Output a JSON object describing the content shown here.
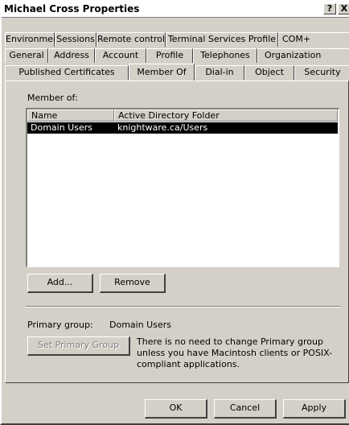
{
  "window": {
    "title": "Michael Cross Properties",
    "help_button": "?",
    "close_button": "X"
  },
  "tabs": {
    "row1": [
      "Environment",
      "Sessions",
      "Remote control",
      "Terminal Services Profile",
      "COM+"
    ],
    "row2": [
      "General",
      "Address",
      "Account",
      "Profile",
      "Telephones",
      "Organization"
    ],
    "row3": [
      "Published Certificates",
      "Member Of",
      "Dial-in",
      "Object",
      "Security"
    ],
    "active": "Member Of"
  },
  "member_of": {
    "label": "Member of:",
    "columns": [
      "Name",
      "Active Directory Folder"
    ],
    "rows": [
      {
        "name": "Domain Users",
        "folder": "knightware.ca/Users"
      }
    ]
  },
  "buttons": {
    "add": "Add...",
    "remove": "Remove",
    "set_primary_group": "Set Primary Group",
    "ok": "OK",
    "cancel": "Cancel",
    "apply": "Apply"
  },
  "primary_group": {
    "label": "Primary group:",
    "value": "Domain Users",
    "note": "There is no need to change Primary group unless you have Macintosh clients or POSIX-compliant applications."
  }
}
